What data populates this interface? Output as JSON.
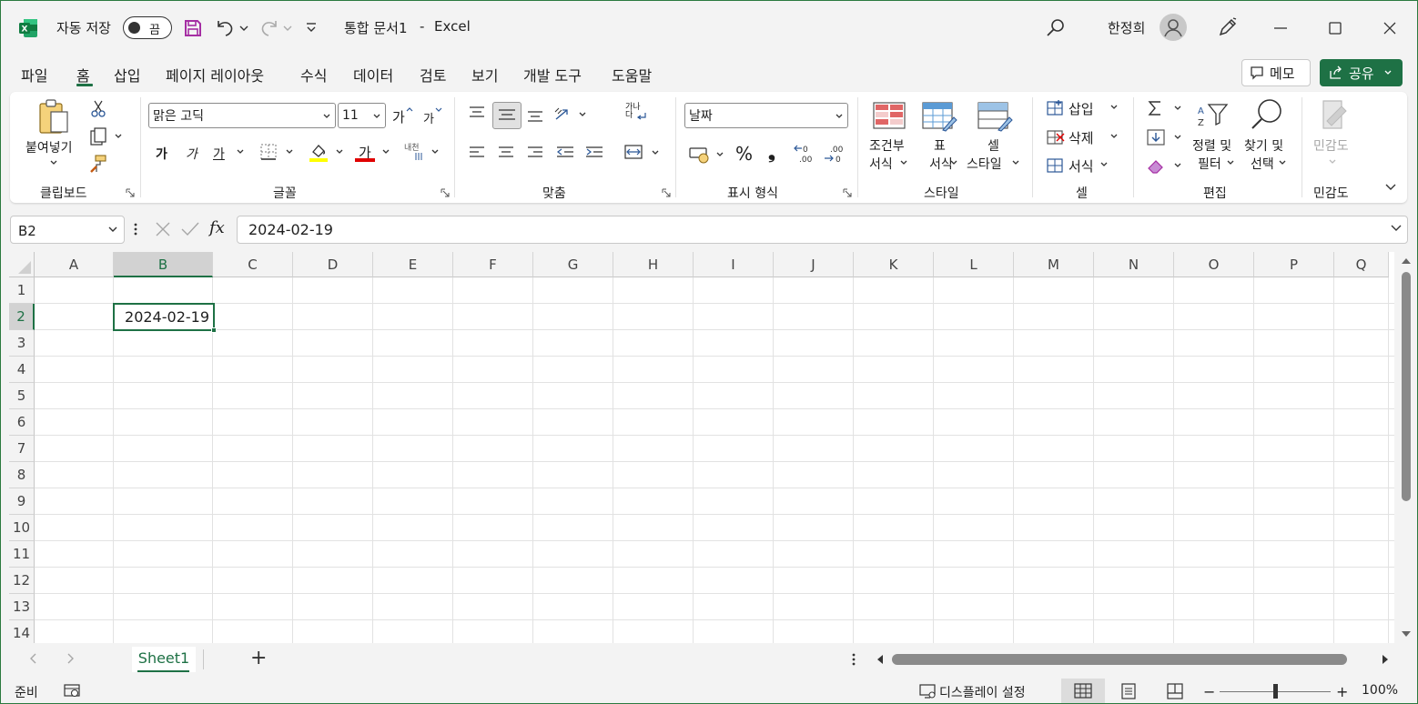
{
  "titlebar": {
    "autosave_label": "자동 저장",
    "autosave_state": "끔",
    "document_title": "통합 문서1",
    "separator": "-",
    "app_name": "Excel",
    "user_name": "한정희"
  },
  "menu": {
    "tabs": [
      {
        "label": "파일"
      },
      {
        "label": "홈"
      },
      {
        "label": "삽입"
      },
      {
        "label": "페이지 레이아웃"
      },
      {
        "label": "수식"
      },
      {
        "label": "데이터"
      },
      {
        "label": "검토"
      },
      {
        "label": "보기"
      },
      {
        "label": "개발 도구"
      },
      {
        "label": "도움말"
      }
    ],
    "memo_label": "메모",
    "share_label": "공유"
  },
  "ribbon": {
    "clipboard": {
      "paste_label": "붙여넣기",
      "group_label": "클립보드"
    },
    "font": {
      "font_name": "맑은 고딕",
      "font_size": "11",
      "grow_label": "가",
      "shrink_label": "가",
      "bold_label": "가",
      "italic_label": "가",
      "underline_label": "가",
      "fontcolor_label": "가",
      "phonetic_label": "내천",
      "group_label": "글꼴"
    },
    "alignment": {
      "wrap_label": "가나다",
      "group_label": "맞춤"
    },
    "number": {
      "format": "날짜",
      "percent": "%",
      "comma": "❟",
      "group_label": "표시 형식"
    },
    "styles": {
      "conditional_line1": "조건부",
      "conditional_line2": "서식",
      "table_line1": "표",
      "table_line2": "서식",
      "cell_line1": "셀",
      "cell_line2": "스타일",
      "group_label": "스타일"
    },
    "cells": {
      "insert_label": "삽입",
      "delete_label": "삭제",
      "format_label": "서식",
      "group_label": "셀"
    },
    "editing": {
      "sort_line1": "정렬 및",
      "sort_line2": "필터",
      "find_line1": "찾기 및",
      "find_line2": "선택",
      "group_label": "편집"
    },
    "sensitivity": {
      "label": "민감도",
      "group_label": "민감도"
    }
  },
  "formula_bar": {
    "name_box": "B2",
    "fx_label": "fx",
    "content": "2024-02-19"
  },
  "grid": {
    "columns": [
      "A",
      "B",
      "C",
      "D",
      "E",
      "F",
      "G",
      "H",
      "I",
      "J",
      "K",
      "L",
      "M",
      "N",
      "O",
      "P",
      "Q"
    ],
    "rows": [
      "1",
      "2",
      "3",
      "4",
      "5",
      "6",
      "7",
      "8",
      "9",
      "10",
      "11",
      "12",
      "13",
      "14"
    ],
    "selected_cell_value": "2024-02-19"
  },
  "sheets": {
    "tabs": [
      {
        "label": "Sheet1"
      }
    ],
    "add_label": "+"
  },
  "status_bar": {
    "ready": "준비",
    "display_settings": "디스플레이 설정",
    "zoom": "100%",
    "minus": "−",
    "plus": "+"
  },
  "colors": {
    "accent": "#1e7145",
    "highlight_yellow": "#ffff00",
    "font_red": "#e00000",
    "brand_purple": "#a52ea3"
  }
}
